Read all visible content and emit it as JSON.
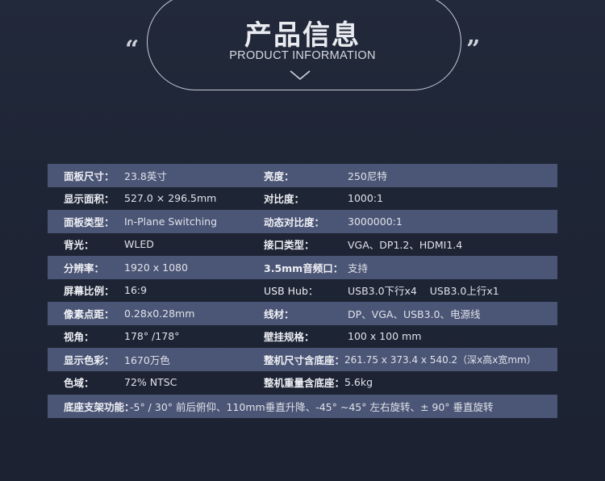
{
  "header": {
    "title_cn": "产品信息",
    "title_en": "PRODUCT INFORMATION",
    "quote_open": "“",
    "quote_close": "”"
  },
  "specs": [
    {
      "k1": "面板尺寸：",
      "v1": "23.8英寸",
      "k2": "亮度：",
      "v2": "250尼特"
    },
    {
      "k1": "显示面积：",
      "v1": " 527.0 × 296.5mm",
      "k2": "对比度：",
      "v2": "1000:1"
    },
    {
      "k1": "面板类型：",
      "v1": "In-Plane Switching",
      "k2": "动态对比度：",
      "v2": "3000000:1"
    },
    {
      "k1": "背光：",
      "v1": "WLED",
      "k2": "接口类型：",
      "v2": "VGA、DP1.2、HDMI1.4"
    },
    {
      "k1": "分辨率：",
      "v1": "1920 x 1080",
      "k2": "3.5mm音频口：",
      "v2": "支持"
    },
    {
      "k1": "屏幕比例：",
      "v1": "16:9",
      "k2": "USB  Hub：",
      "v2": "USB3.0下行x4    USB3.0上行x1"
    },
    {
      "k1": "像素点距：",
      "v1": "0.28x0.28mm",
      "k2": "线材：",
      "v2": "DP、VGA、USB3.0、电源线"
    },
    {
      "k1": "视角：",
      "v1": "178°  /178°",
      "k2": "壁挂规格：",
      "v2": "100 x 100 mm"
    },
    {
      "k1": "显示色彩：",
      "v1": "1670万色",
      "k2": "整机尺寸含底座：",
      "v2": "261.75 x 373.4 x 540.2（深x高x宽mm）"
    },
    {
      "k1": "色域：",
      "v1": "72% NTSC",
      "k2": "整机重量含底座：",
      "v2": "5.6kg"
    }
  ],
  "stand": {
    "label": "底座支架功能：",
    "value": "-5° / 30° 前后俯仰、110mm垂直升降、-45° ~45° 左右旋转、± 90° 垂直旋转"
  }
}
